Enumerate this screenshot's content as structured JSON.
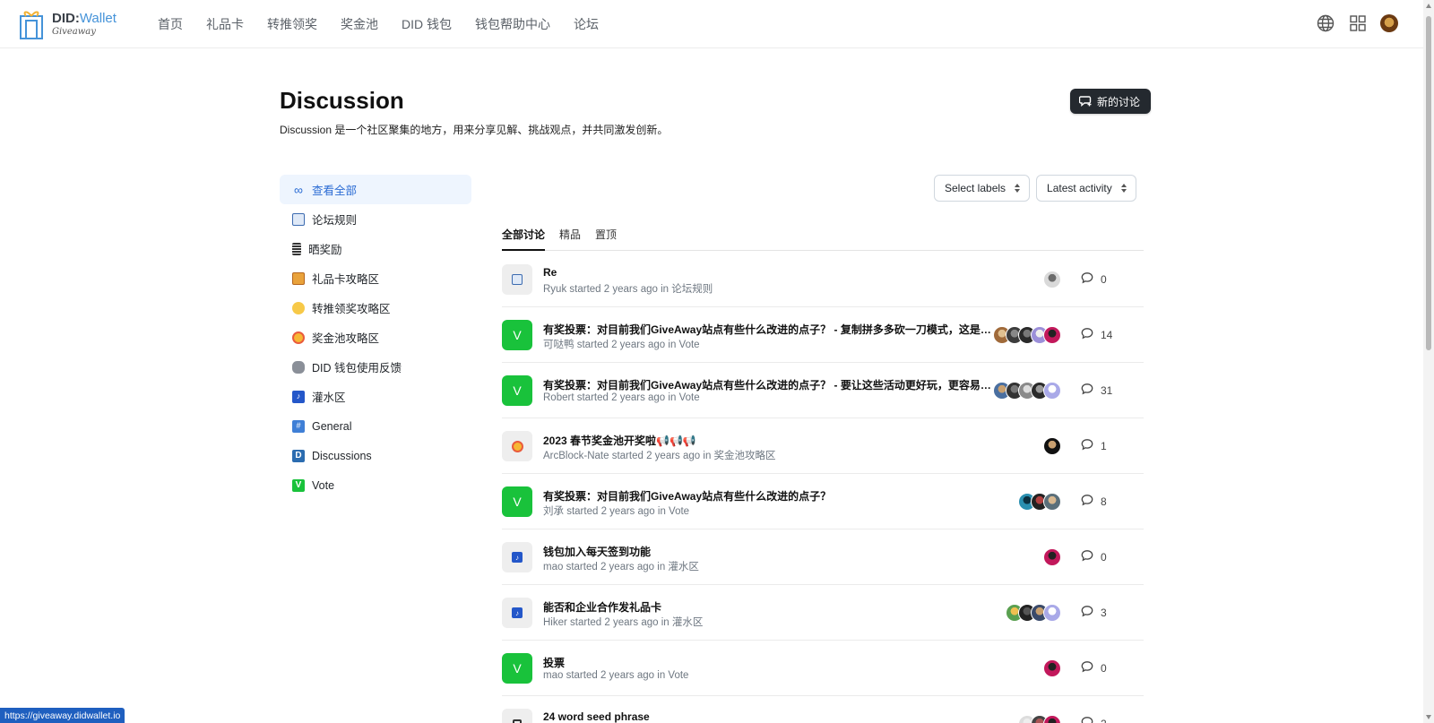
{
  "header": {
    "logo_title_left": "DID:",
    "logo_title_right": "Wallet",
    "logo_sub": "Giveaway",
    "nav": [
      "首页",
      "礼品卡",
      "转推领奖",
      "奖金池",
      "DID 钱包",
      "钱包帮助中心",
      "论坛"
    ]
  },
  "page": {
    "title": "Discussion",
    "description": "Discussion 是一个社区聚集的地方，用来分享见解、挑战观点，并共同激发创新。",
    "new_button": "新的讨论"
  },
  "sidebar": {
    "items": [
      {
        "label": "查看全部",
        "icon": "infinity-icon",
        "active": true
      },
      {
        "label": "论坛规则",
        "icon": "rules-icon"
      },
      {
        "label": "晒奖励",
        "icon": "stack-icon"
      },
      {
        "label": "礼品卡攻略区",
        "icon": "gift-icon"
      },
      {
        "label": "转推领奖攻略区",
        "icon": "grin-face-icon"
      },
      {
        "label": "奖金池攻略区",
        "icon": "star-face-icon"
      },
      {
        "label": "DID 钱包使用反馈",
        "icon": "bear-icon"
      },
      {
        "label": "灌水区",
        "icon": "music-icon"
      },
      {
        "label": "General",
        "icon": "hash-icon"
      },
      {
        "label": "Discussions",
        "icon": "letter-d-icon"
      },
      {
        "label": "Vote",
        "icon": "letter-v-icon"
      }
    ]
  },
  "filters": {
    "labels": "Select labels",
    "sort": "Latest activity"
  },
  "tabs": [
    "全部讨论",
    "精品",
    "置顶"
  ],
  "colors": {
    "accent": "#2b6cd4",
    "vote_green": "#19c23b",
    "dark_button": "#24292f"
  },
  "threads": [
    {
      "title": "Re",
      "author": "Ryuk",
      "time": "2 years ago",
      "category": "论坛规则",
      "icon": "rules-icon",
      "replies": "0"
    },
    {
      "title": "有奖投票：对目前我们GiveAway站点有些什么改进的点子？ - 复制拼多多砍一刀模式，这是成本最低的推广方式",
      "author": "可哒鸭",
      "time": "2 years ago",
      "category": "Vote",
      "icon": "vote-icon",
      "replies": "14"
    },
    {
      "title": "有奖投票：对目前我们GiveAway站点有些什么改进的点子？ - 要让这些活动更好玩，更容易互动",
      "author": "Robert",
      "time": "2 years ago",
      "category": "Vote",
      "icon": "vote-icon",
      "replies": "31"
    },
    {
      "title": "2023 春节奖金池开奖啦📢📢📢",
      "author": "ArcBlock-Nate",
      "time": "2 years ago",
      "category": "奖金池攻略区",
      "icon": "star-face-icon",
      "replies": "1"
    },
    {
      "title": "有奖投票：对目前我们GiveAway站点有些什么改进的点子？",
      "author": "刘承",
      "time": "2 years ago",
      "category": "Vote",
      "icon": "vote-icon",
      "replies": "8"
    },
    {
      "title": "钱包加入每天签到功能",
      "author": "mao",
      "time": "2 years ago",
      "category": "灌水区",
      "icon": "music-icon",
      "replies": "0"
    },
    {
      "title": "能否和企业合作发礼品卡",
      "author": "Hiker",
      "time": "2 years ago",
      "category": "灌水区",
      "icon": "music-icon",
      "replies": "3"
    },
    {
      "title": "投票",
      "author": "mao",
      "time": "2 years ago",
      "category": "Vote",
      "icon": "vote-icon",
      "replies": "0"
    },
    {
      "title": "24 word seed phrase",
      "author": "",
      "time": "",
      "category": "",
      "icon": "doc-icon",
      "replies": "2"
    }
  ],
  "text": {
    "started": "started",
    "in": "in",
    "vote_letter": "V"
  },
  "status_bar": {
    "url": "https://giveaway.didwallet.io"
  }
}
